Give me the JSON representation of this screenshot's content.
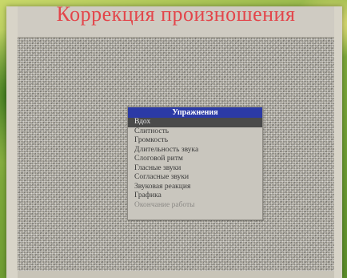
{
  "app": {
    "title": "Коррекция произношения"
  },
  "menu": {
    "header": "Упражнения",
    "items": [
      {
        "label": "Вдох",
        "selected": true
      },
      {
        "label": "Слитность",
        "selected": false
      },
      {
        "label": "Громкость",
        "selected": false
      },
      {
        "label": "Длительность звука",
        "selected": false
      },
      {
        "label": "Слоговой ритм",
        "selected": false
      },
      {
        "label": "Гласные звуки",
        "selected": false
      },
      {
        "label": "Согласные звуки",
        "selected": false
      },
      {
        "label": "Звуковая реакция",
        "selected": false
      },
      {
        "label": "Графика",
        "selected": false
      },
      {
        "label": "Окончание работы",
        "selected": false,
        "dim": true
      }
    ]
  },
  "colors": {
    "title_text": "#e3454a",
    "menu_header_bg": "#2b3aa6",
    "selected_bg": "#4a4a4a",
    "screen_bg": "#b7b3a8"
  }
}
